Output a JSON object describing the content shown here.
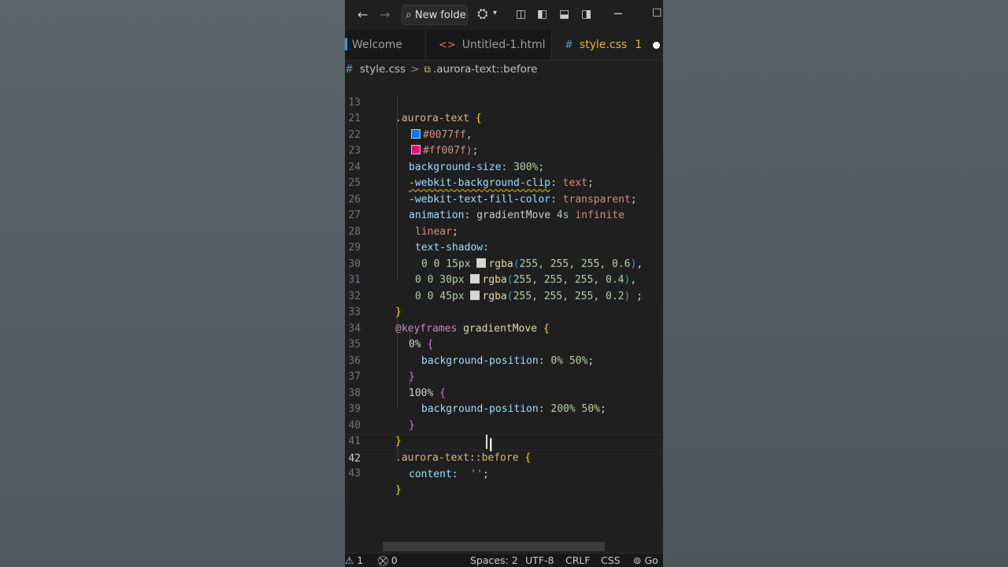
{
  "titlebar": {
    "search_text": "New folde"
  },
  "tabs": [
    {
      "label": "Welcome",
      "active": false
    },
    {
      "label": "Untitled-1.html",
      "icon": "<>",
      "active": false
    },
    {
      "label": "style.css",
      "icon": "#",
      "badge": "1",
      "active": true,
      "modified": true
    }
  ],
  "breadcrumb": {
    "file": "style.css",
    "sep": ">",
    "symbol": ".aurora-text::before"
  },
  "lines": {
    "n13": "13",
    "n21": "21",
    "n22": "22",
    "n23": "23",
    "n24": "24",
    "n25": "25",
    "n26": "26",
    "n27": "27",
    "n28": "28",
    "n29": "29",
    "n30": "30",
    "n31": "31",
    "n32": "32",
    "n33": "33",
    "n34": "34",
    "n35": "35",
    "n36": "36",
    "n37": "37",
    "n38": "38",
    "n39": "39",
    "n40": "40",
    "n41": "41",
    "n42": "42",
    "n43": "43"
  },
  "code": {
    "sel_aurora": ".aurora-text",
    "brace_open": "{",
    "brace_close": "}",
    "color1": "#0077ff",
    "color2": "#ff007f",
    "comma": ",",
    "semi": ";",
    "colon": ":",
    "prop_bgsize": "background-size",
    "val_300": "300%",
    "prop_bgclip": "-webkit-background-clip",
    "val_text": "text",
    "prop_fill": "-webkit-text-fill-color",
    "val_transparent": "transparent",
    "prop_anim": "animation",
    "val_gradname": "gradientMove",
    "val_4s": "4s",
    "val_infinite": "infinite",
    "val_linear": "linear",
    "prop_shadow": "text-shadow",
    "shadow1_dims": "0 0 15px",
    "shadow2_dims": "0 0 30px",
    "shadow3_dims": "0 0 45px",
    "fn_rgba": "rgba",
    "paren_open": "(",
    "paren_close": ")",
    "rgb_vals": "255, 255, 255, ",
    "alpha1": "0.6",
    "alpha2": "0.4",
    "alpha3": "0.2",
    "at_keyframes": "@keyframes",
    "kf_name": "gradientMove",
    "kf_0": "0%",
    "kf_100": "100%",
    "prop_bgpos": "background-position",
    "val_0": "0%",
    "val_50": "50%",
    "val_200": "200%",
    "sel_before": ".aurora-text::before",
    "prop_content": "content",
    "val_empty": "''"
  },
  "colors": {
    "swatch1": "#0077ff",
    "swatch2": "#ff007f",
    "swatch_white": "#ffffff"
  },
  "status": {
    "problems": "1",
    "ports": "0",
    "spaces": "Spaces: 2",
    "encoding": "UTF-8",
    "eol": "CRLF",
    "language": "CSS",
    "golive": "Go"
  }
}
